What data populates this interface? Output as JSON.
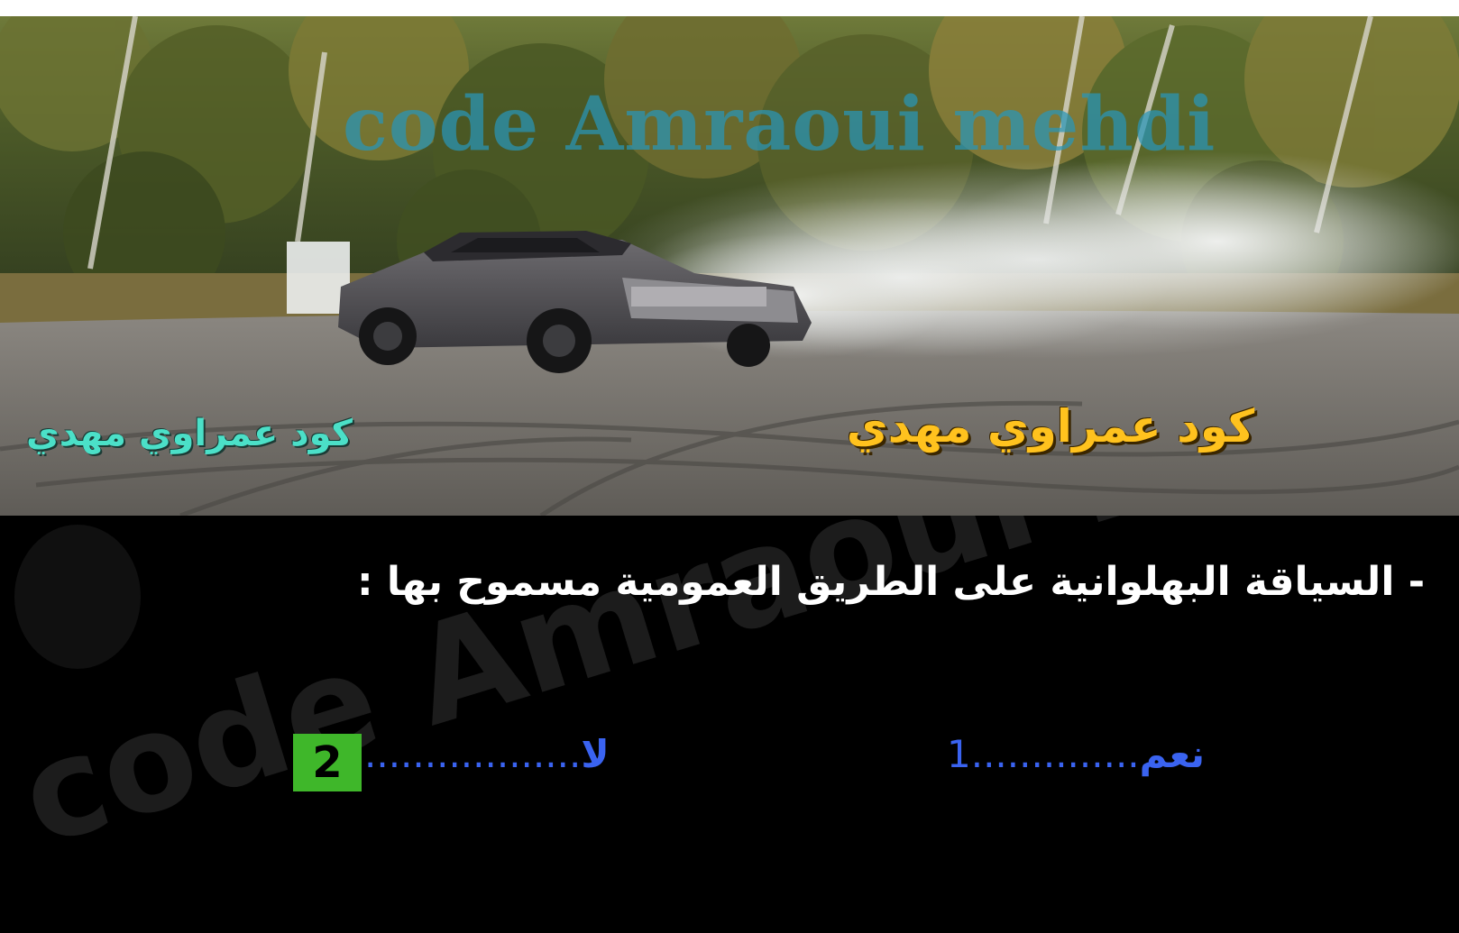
{
  "photo": {
    "watermark": "code Amraoui mehdi",
    "caption_left": "كود عمراوي مهدي",
    "caption_right": "كود عمراوي مهدي",
    "colors": {
      "caption_left": "#4be0c8",
      "caption_right": "#ffc21e",
      "watermark": "#2896b9"
    }
  },
  "quiz": {
    "question": "- السياقة البهلوانية على الطريق العمومية مسموح بها :",
    "watermark": "code Amraoui mehdi",
    "answers": [
      {
        "label": "نعم",
        "dots": "..............",
        "number": "1"
      },
      {
        "label": "لا",
        "dots": "..................",
        "number": "2"
      }
    ],
    "correct_answer": "2",
    "colors": {
      "answer_text": "#3a63f0",
      "correct_badge": "#3fb72a",
      "background": "#000000"
    }
  }
}
